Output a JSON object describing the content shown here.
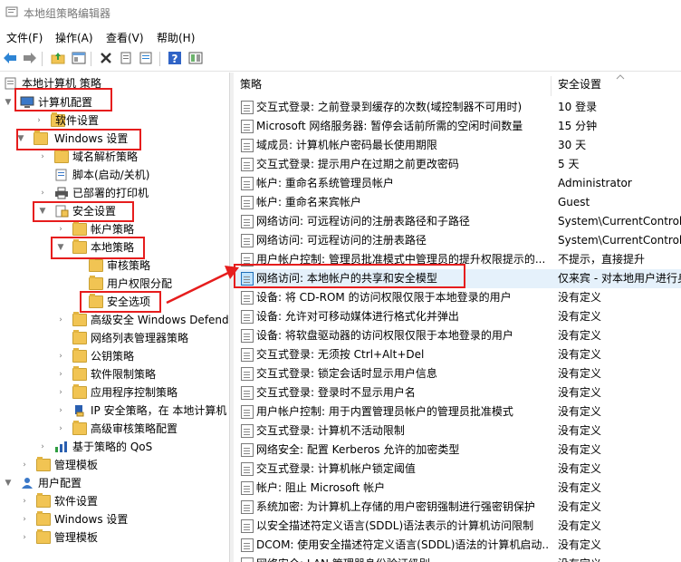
{
  "window": {
    "title": "本地组策略编辑器"
  },
  "menu": [
    "文件(F)",
    "操作(A)",
    "查看(V)",
    "帮助(H)"
  ],
  "tree": {
    "root": "本地计算机 策略",
    "computer_config": "计算机配置",
    "software_settings": "软件设置",
    "windows_settings": "Windows 设置",
    "dns_policy": "域名解析策略",
    "scripts": "脚本(启动/关机)",
    "printers": "已部署的打印机",
    "security_settings": "安全设置",
    "account_policies": "帐户策略",
    "local_policies": "本地策略",
    "audit_policy": "审核策略",
    "user_rights": "用户权限分配",
    "security_options": "安全选项",
    "firewall": "高级安全 Windows Defende",
    "netlist": "网络列表管理器策略",
    "pubkey": "公钥策略",
    "software_restriction": "软件限制策略",
    "app_control": "应用程序控制策略",
    "ipsec": "IP 安全策略，在 本地计算机",
    "adv_audit": "高级审核策略配置",
    "qos": "基于策略的 QoS",
    "admin_templates": "管理模板",
    "user_config": "用户配置",
    "user_software": "软件设置",
    "user_windows": "Windows 设置",
    "user_admin": "管理模板"
  },
  "table": {
    "col_policy": "策略",
    "col_setting": "安全设置",
    "rows": [
      {
        "name": "交互式登录: 之前登录到缓存的次数(域控制器不可用时)",
        "value": "10 登录"
      },
      {
        "name": "Microsoft 网络服务器: 暂停会话前所需的空闲时间数量",
        "value": "15 分钟"
      },
      {
        "name": "域成员: 计算机帐户密码最长使用期限",
        "value": "30 天"
      },
      {
        "name": "交互式登录: 提示用户在过期之前更改密码",
        "value": "5 天"
      },
      {
        "name": "帐户: 重命名系统管理员帐户",
        "value": "Administrator"
      },
      {
        "name": "帐户: 重命名来宾帐户",
        "value": "Guest"
      },
      {
        "name": "网络访问: 可远程访问的注册表路径和子路径",
        "value": "System\\CurrentControlSet"
      },
      {
        "name": "网络访问: 可远程访问的注册表路径",
        "value": "System\\CurrentControlSet"
      },
      {
        "name": "用户帐户控制: 管理员批准模式中管理员的提升权限提示的...",
        "value": "不提示，直接提升"
      },
      {
        "name": "网络访问: 本地帐户的共享和安全模型",
        "value": "仅来宾 - 对本地用户进行身份验证"
      },
      {
        "name": "设备: 将 CD-ROM 的访问权限仅限于本地登录的用户",
        "value": "没有定义"
      },
      {
        "name": "设备: 允许对可移动媒体进行格式化并弹出",
        "value": "没有定义"
      },
      {
        "name": "设备: 将软盘驱动器的访问权限仅限于本地登录的用户",
        "value": "没有定义"
      },
      {
        "name": "交互式登录: 无须按 Ctrl+Alt+Del",
        "value": "没有定义"
      },
      {
        "name": "交互式登录: 锁定会话时显示用户信息",
        "value": "没有定义"
      },
      {
        "name": "交互式登录: 登录时不显示用户名",
        "value": "没有定义"
      },
      {
        "name": "用户帐户控制: 用于内置管理员帐户的管理员批准模式",
        "value": "没有定义"
      },
      {
        "name": "交互式登录: 计算机不活动限制",
        "value": "没有定义"
      },
      {
        "name": "网络安全: 配置 Kerberos 允许的加密类型",
        "value": "没有定义"
      },
      {
        "name": "交互式登录: 计算机帐户锁定阈值",
        "value": "没有定义"
      },
      {
        "name": "帐户: 阻止 Microsoft 帐户",
        "value": "没有定义"
      },
      {
        "name": "系统加密: 为计算机上存储的用户密钥强制进行强密钥保护",
        "value": "没有定义"
      },
      {
        "name": "以安全描述符定义语言(SDDL)语法表示的计算机访问限制",
        "value": "没有定义"
      },
      {
        "name": "DCOM: 使用安全描述符定义语言(SDDL)语法的计算机启动...",
        "value": "没有定义"
      },
      {
        "name": "网络安全: LAN 管理器身份验证级别",
        "value": "没有定义"
      }
    ]
  }
}
